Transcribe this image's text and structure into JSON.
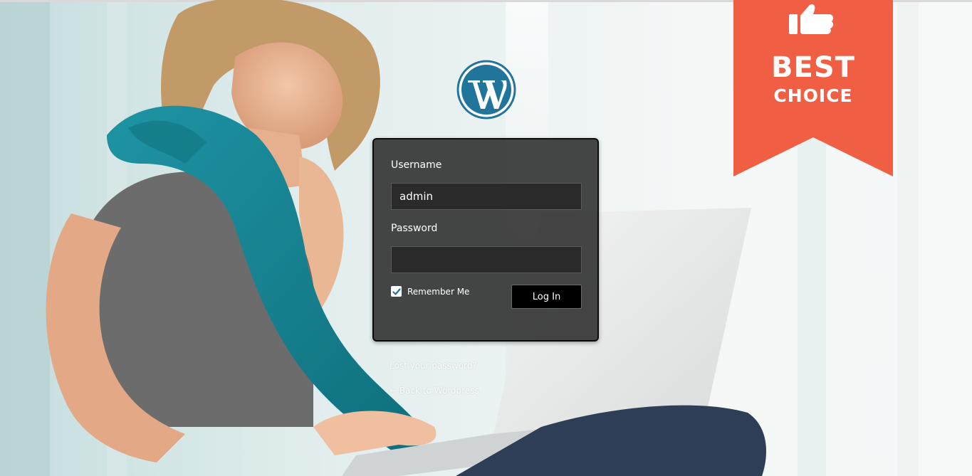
{
  "form": {
    "username_label": "Username",
    "username_value": "admin",
    "password_label": "Password",
    "password_value": "",
    "remember_label": "Remember Me",
    "remember_checked": true,
    "login_label": "Log In"
  },
  "links": {
    "lost_password": "Lost your password?",
    "back_to_site": "← Back to Wordpress"
  },
  "badge": {
    "line1": "BEST",
    "line2": "CHOICE",
    "color": "#f05f44"
  },
  "icons": {
    "logo": "wordpress-logo-icon",
    "badge_icon": "thumbs-up-icon",
    "checkbox": "check-icon"
  },
  "colors": {
    "wp_blue": "#21759b",
    "box_bg": "#2b2b2b",
    "button_bg": "#000000"
  }
}
